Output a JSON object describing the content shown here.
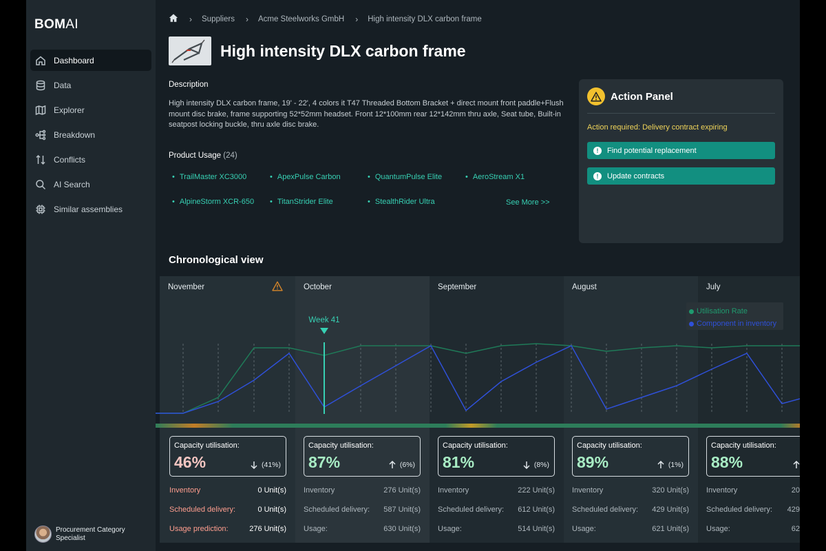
{
  "app": {
    "logo_bold": "BOM",
    "logo_light": "AI"
  },
  "sidebar": {
    "items": [
      {
        "label": "Dashboard",
        "icon": "home-icon",
        "active": true
      },
      {
        "label": "Data",
        "icon": "database-icon",
        "active": false
      },
      {
        "label": "Explorer",
        "icon": "map-icon",
        "active": false
      },
      {
        "label": "Breakdown",
        "icon": "hierarchy-icon",
        "active": false
      },
      {
        "label": "Conflicts",
        "icon": "swap-arrows-icon",
        "active": false
      },
      {
        "label": "AI Search",
        "icon": "search-icon",
        "active": false
      },
      {
        "label": "Similar assemblies",
        "icon": "chip-icon",
        "active": false
      }
    ],
    "user": {
      "name": "Procurement Category Specialist"
    }
  },
  "breadcrumb": {
    "items": [
      "Suppliers",
      "Acme Steelworks GmbH",
      "High intensity DLX carbon frame"
    ]
  },
  "product": {
    "title": "High intensity DLX carbon frame",
    "description_heading": "Description",
    "description": "High intensity DLX carbon frame, 19' - 22', 4 colors it T47 Threaded Bottom Bracket + direct mount front paddle+Flush mount disc brake, frame supporting 52*52mm headset. Front 12*100mm rear 12*142mm thru axle, Seat tube, Built-in seatpost locking buckle, thru axle disc brake.",
    "usage_heading": "Product Usage",
    "usage_count": "(24)",
    "usage_items": [
      "TrailMaster XC3000",
      "ApexPulse Carbon",
      "QuantumPulse Elite",
      "AeroStream X1",
      "AlpineStorm XCR-650",
      "TitanStrider Elite",
      "StealthRider Ultra"
    ],
    "see_more": "See More >>"
  },
  "action_panel": {
    "title": "Action Panel",
    "alert": "Action required: Delivery contract expiring",
    "buttons": [
      "Find potential replacement",
      "Update contracts"
    ],
    "colors": {
      "button": "#128f80",
      "alert": "#f0d45a",
      "badge": "#f2c12e"
    }
  },
  "chrono": {
    "heading": "Chronological view",
    "marker_label": "Week 41",
    "legend": [
      {
        "name": "Utilisation Rate",
        "color": "#1f9a6e"
      },
      {
        "name": "Component in inventory",
        "color": "#2f50d8"
      }
    ],
    "months": [
      {
        "name": "November",
        "warning": true,
        "card_label": "Capacity utilisation:",
        "pct": "46%",
        "pct_color": "#f5c6c2",
        "trend": "down",
        "delta": "(41%)",
        "stats": [
          {
            "label": "Inventory",
            "value": "0 Unit(s)"
          },
          {
            "label": "Scheduled delivery:",
            "value": "0 Unit(s)"
          },
          {
            "label": "Usage prediction:",
            "value": "276 Unit(s)"
          }
        ]
      },
      {
        "name": "October",
        "warning": false,
        "card_label": "Capacity utilisation:",
        "pct": "87%",
        "pct_color": "#a8ecc4",
        "trend": "up",
        "delta": "(6%)",
        "stats": [
          {
            "label": "Inventory",
            "value": "276 Unit(s)"
          },
          {
            "label": "Scheduled delivery:",
            "value": "587 Unit(s)"
          },
          {
            "label": "Usage:",
            "value": "630 Unit(s)"
          }
        ]
      },
      {
        "name": "September",
        "warning": false,
        "card_label": "Capacity utilisation:",
        "pct": "81%",
        "pct_color": "#a8ecc4",
        "trend": "down",
        "delta": "(8%)",
        "stats": [
          {
            "label": "Inventory",
            "value": "222 Unit(s)"
          },
          {
            "label": "Scheduled delivery:",
            "value": "612 Unit(s)"
          },
          {
            "label": "Usage:",
            "value": "514 Unit(s)"
          }
        ]
      },
      {
        "name": "August",
        "warning": false,
        "card_label": "Capacity utilisation:",
        "pct": "89%",
        "pct_color": "#a8ecc4",
        "trend": "up",
        "delta": "(1%)",
        "stats": [
          {
            "label": "Inventory",
            "value": "320 Unit(s)"
          },
          {
            "label": "Scheduled delivery:",
            "value": "429 Unit(s)"
          },
          {
            "label": "Usage:",
            "value": "621 Unit(s)"
          }
        ]
      },
      {
        "name": "July",
        "warning": false,
        "card_label": "Capacity utilisation:",
        "pct": "88%",
        "pct_color": "#a8ecc4",
        "trend": "up",
        "delta": "",
        "stats": [
          {
            "label": "Inventory",
            "value": "20"
          },
          {
            "label": "Scheduled delivery:",
            "value": "429"
          },
          {
            "label": "Usage:",
            "value": "62"
          }
        ]
      }
    ]
  }
}
